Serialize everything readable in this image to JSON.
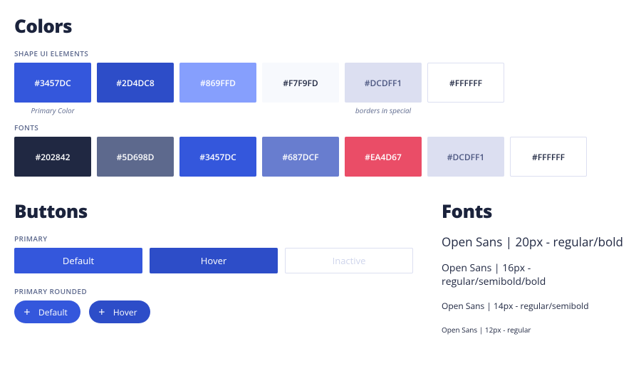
{
  "colors": {
    "title": "Colors",
    "row1_label": "SHAPE UI ELEMENTS",
    "row2_label": "FONTS",
    "row1": [
      {
        "hex": "#3457DC",
        "bg": "#3457DC",
        "fg": "#ffffff",
        "caption": "Primary Color"
      },
      {
        "hex": "#2D4DC8",
        "bg": "#2D4DC8",
        "fg": "#ffffff",
        "caption": ""
      },
      {
        "hex": "#869FFD",
        "bg": "#869FFD",
        "fg": "#ffffff",
        "caption": ""
      },
      {
        "hex": "#F7F9FD",
        "bg": "#F7F9FD",
        "fg": "#202842",
        "caption": ""
      },
      {
        "hex": "#DCDFF1",
        "bg": "#DCDFF1",
        "fg": "#4b5680",
        "caption": "borders in special"
      },
      {
        "hex": "#FFFFFF",
        "bg": "#FFFFFF",
        "fg": "#202842",
        "caption": "",
        "bordered": true
      }
    ],
    "row2": [
      {
        "hex": "#202842",
        "bg": "#202842",
        "fg": "#ffffff"
      },
      {
        "hex": "#5D698D",
        "bg": "#5D698D",
        "fg": "#ffffff"
      },
      {
        "hex": "#3457DC",
        "bg": "#3457DC",
        "fg": "#ffffff"
      },
      {
        "hex": "#687DCF",
        "bg": "#687DCF",
        "fg": "#ffffff"
      },
      {
        "hex": "#EA4D67",
        "bg": "#EA4D67",
        "fg": "#ffffff"
      },
      {
        "hex": "#DCDFF1",
        "bg": "#DCDFF1",
        "fg": "#4b5680"
      },
      {
        "hex": "#FFFFFF",
        "bg": "#FFFFFF",
        "fg": "#202842",
        "bordered": true
      }
    ]
  },
  "buttons": {
    "title": "Buttons",
    "primary_label": "PRIMARY",
    "primary": {
      "default": "Default",
      "hover": "Hover",
      "inactive": "Inactive"
    },
    "rounded_label": "PRIMARY ROUNDED",
    "rounded": {
      "default": "Default",
      "hover": "Hover"
    }
  },
  "fonts": {
    "title": "Fonts",
    "lines": [
      "Open Sans | 20px - regular/bold",
      "Open Sans | 16px - regular/semibold/bold",
      "Open Sans | 14px - regular/semibold",
      "Open Sans | 12px - regular"
    ]
  }
}
